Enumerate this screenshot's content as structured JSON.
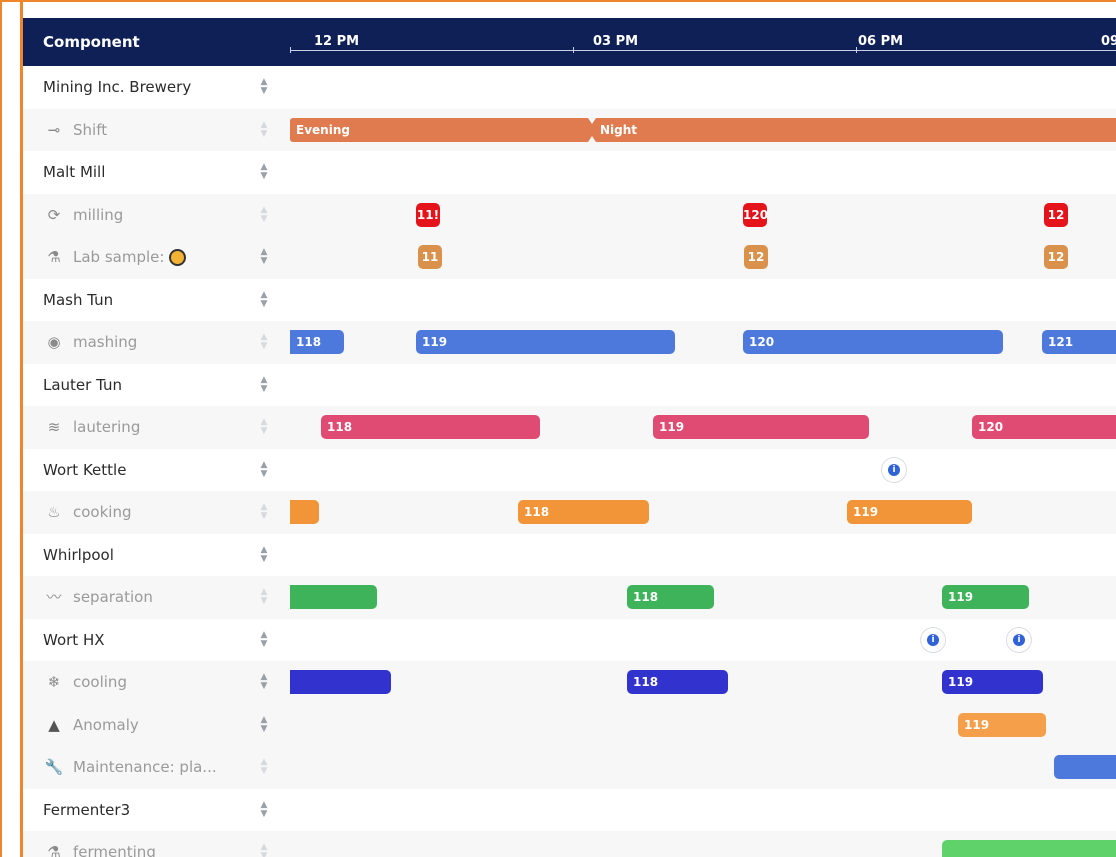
{
  "header": {
    "title": "Component",
    "ticks": [
      "12 PM",
      "03 PM",
      "06 PM",
      "09 P"
    ]
  },
  "rows": [
    {
      "label": "Mining Inc. Brewery",
      "sub": false
    },
    {
      "label": "Shift",
      "sub": true,
      "icon": "shift-icon"
    },
    {
      "label": "Malt Mill",
      "sub": false
    },
    {
      "label": "milling",
      "sub": true,
      "icon": "refresh-icon"
    },
    {
      "label": "Lab sample:",
      "sub": true,
      "icon": "flask-icon",
      "extra_icon": "beer-mug-icon"
    },
    {
      "label": "Mash Tun",
      "sub": false
    },
    {
      "label": "mashing",
      "sub": true,
      "icon": "mash-icon"
    },
    {
      "label": "Lauter Tun",
      "sub": false
    },
    {
      "label": "lautering",
      "sub": true,
      "icon": "waves-icon"
    },
    {
      "label": "Wort Kettle",
      "sub": false
    },
    {
      "label": "cooking",
      "sub": true,
      "icon": "flame-icon"
    },
    {
      "label": "Whirlpool",
      "sub": false
    },
    {
      "label": "separation",
      "sub": true,
      "icon": "chart-icon"
    },
    {
      "label": "Wort HX",
      "sub": false
    },
    {
      "label": "cooling",
      "sub": true,
      "icon": "snowflake-icon"
    },
    {
      "label": "Anomaly",
      "sub": true,
      "icon": "warning-icon"
    },
    {
      "label": "Maintenance: pla...",
      "sub": true,
      "icon": "wrench-icon"
    },
    {
      "label": "Fermenter3",
      "sub": false
    },
    {
      "label": "fermenting",
      "sub": true,
      "icon": "flask-icon"
    }
  ],
  "labels": {
    "shift_evening": "Evening",
    "shift_night": "Night",
    "milling_1": "11!",
    "milling_2": "120",
    "milling_3": "12",
    "lab_1": "11",
    "lab_2": "12",
    "lab_3": "12",
    "mashing_1": "118",
    "mashing_2": "119",
    "mashing_3": "120",
    "mashing_4": "121",
    "lauter_1": "118",
    "lauter_2": "119",
    "lauter_3": "120",
    "cooking_1": "118",
    "cooking_2": "119",
    "separation_1": "118",
    "separation_2": "119",
    "cooling_1": "118",
    "cooling_2": "119",
    "anomaly_1": "119"
  },
  "colors": {
    "header": "#0f2057",
    "accent_orange": "#f0862a",
    "shift": "#e07b4f",
    "milling": "#e5141b",
    "lab": "#d9914b",
    "mashing": "#4d79dd",
    "lautering": "#df4b72",
    "cooking": "#f29438",
    "separation": "#3fb35a",
    "cooling": "#3232cf",
    "anomaly": "#f59f4a",
    "maintenance": "#4d79dd",
    "fermenting": "#5fd36a"
  }
}
